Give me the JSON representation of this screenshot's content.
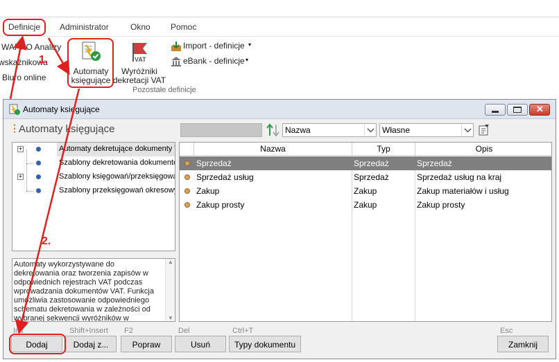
{
  "menu": {
    "items": [
      "Definicje",
      "Administrator",
      "Okno",
      "Pomoc"
    ]
  },
  "ribbon": {
    "left_items": [
      "WAPRO Analizy",
      "wskaźnikowa",
      "Biuro online"
    ],
    "automaty_label_line1": "Automaty",
    "automaty_label_line2": "księgujące",
    "wyrozniki_label_line1": "Wyróżniki",
    "wyrozniki_label_line2": "dekretacji VAT",
    "import_label": "Import - definicje",
    "ebank_label": "eBank - definicje",
    "group_label": "Pozostałe definicje"
  },
  "dialog": {
    "title": "Automaty księgujące",
    "panel_title": "Automaty księgujące",
    "sort_field": "Nazwa",
    "filter_value": "Własne",
    "tree": {
      "items": [
        "Automaty dekretujące dokumenty VAT",
        "Szablony dekretowania dokumentów",
        "Szablony księgowań/przeksięgowań",
        "Szablony przeksięgowań okresowych"
      ]
    },
    "description": "Automaty wykorzystywane do dekretowania oraz tworzenia zapisów w odpowiednich rejestrach VAT podczas wprowadzania dokumentów VAT. Funkcja umożliwia zastosowanie odpowiedniego schematu dekretowania w zależności od wybranej sekwencji wyróżników w dokumencie.",
    "grid": {
      "columns": [
        "Nazwa",
        "Typ",
        "Opis"
      ],
      "rows": [
        {
          "name": "Sprzedaż",
          "type": "Sprzedaż",
          "desc": "Sprzedaż"
        },
        {
          "name": "Sprzedaż usług",
          "type": "Sprzedaż",
          "desc": "Sprzedaż usług na kraj"
        },
        {
          "name": "Zakup",
          "type": "Zakup",
          "desc": "Zakup materiałów i usług"
        },
        {
          "name": "Zakup prosty",
          "type": "Zakup",
          "desc": "Zakup prosty"
        }
      ]
    },
    "buttons": {
      "dodaj": {
        "label": "Dodaj",
        "shortcut": "Ins"
      },
      "dodaj_z": {
        "label": "Dodaj z...",
        "shortcut": "Shift+Insert"
      },
      "popraw": {
        "label": "Popraw",
        "shortcut": "F2"
      },
      "usun": {
        "label": "Usuń",
        "shortcut": "Del"
      },
      "typy": {
        "label": "Typy dokumentu",
        "shortcut": "Ctrl+T"
      },
      "zamknij": {
        "label": "Zamknij",
        "shortcut": "Esc"
      }
    }
  },
  "annotations": {
    "step1": "1.",
    "step2": "2."
  },
  "colors": {
    "annotation": "#e01f1f",
    "selected_row": "#7f7f7f",
    "tree_dot": "#2d64ad",
    "row_dot": "#d9a458"
  }
}
